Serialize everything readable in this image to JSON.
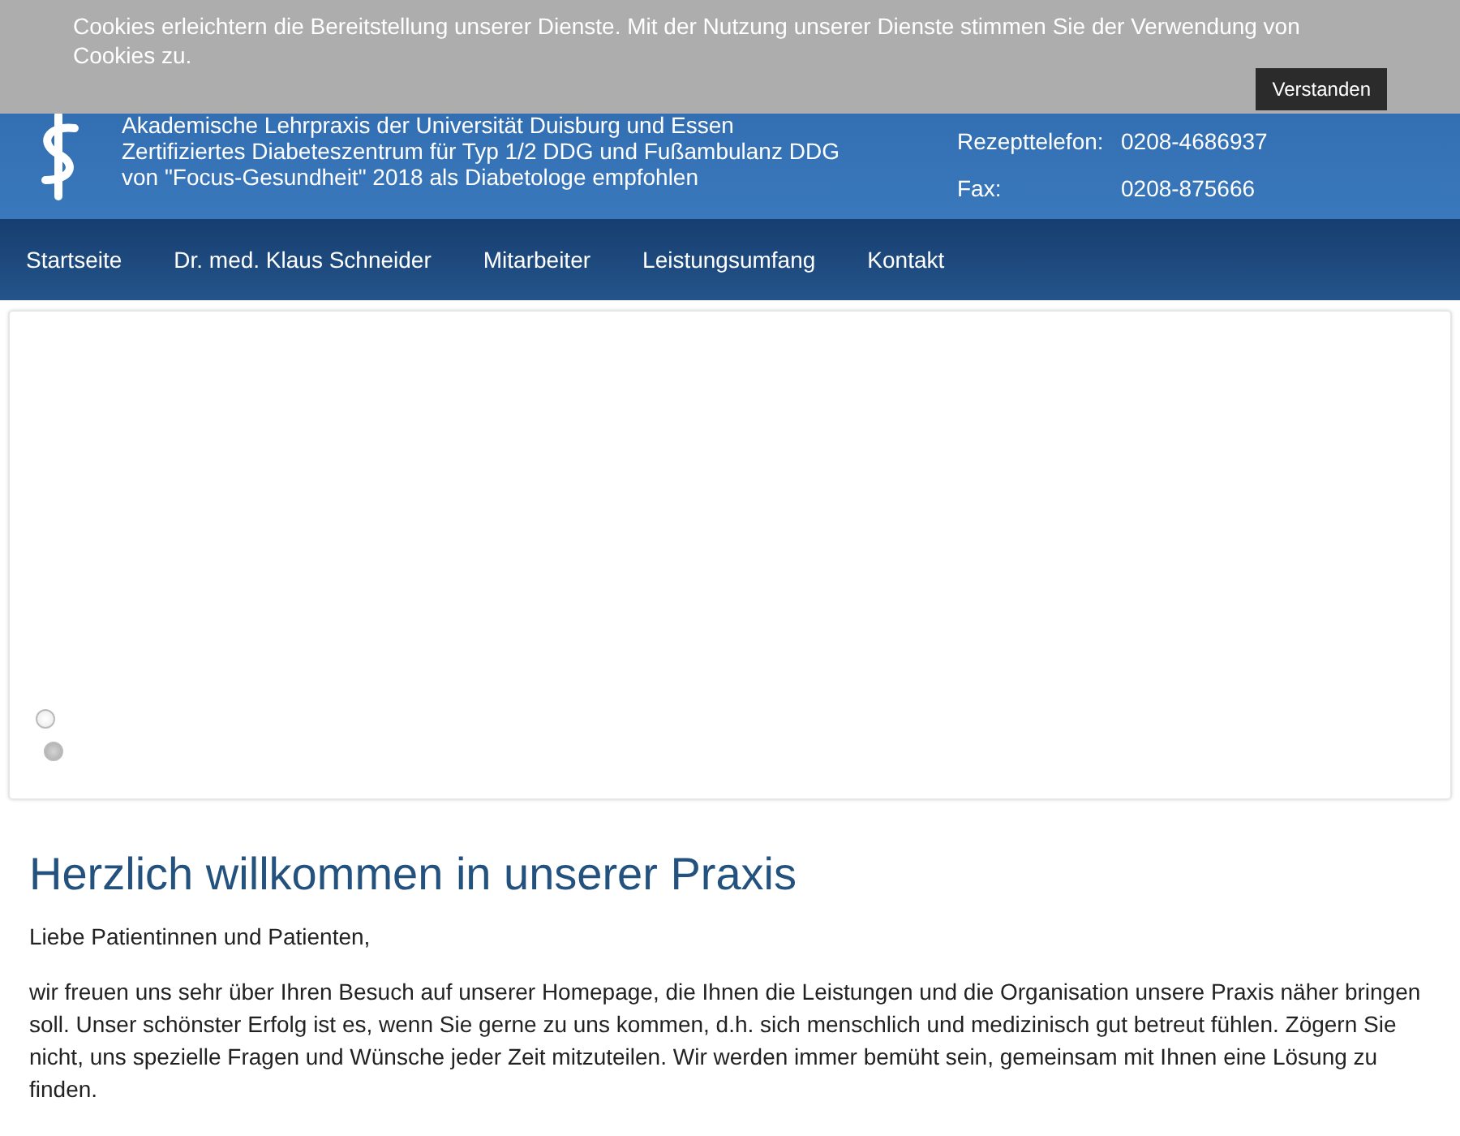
{
  "cookie_banner": {
    "message": "Cookies erleichtern die Bereitstellung unserer Dienste. Mit der Nutzung unserer Dienste stimmen Sie der Verwendung von Cookies zu.",
    "button": "Verstanden"
  },
  "header": {
    "lines": [
      "Akademische Lehrpraxis der Universität Duisburg und Essen",
      "Zertifiziertes Diabeteszentrum für Typ 1/2 DDG und Fußambulanz DDG",
      "von \"Focus-Gesundheit\" 2018 als Diabetologe empfohlen"
    ],
    "contacts": [
      {
        "label": "Rezepttelefon:",
        "value": "0208-4686937"
      },
      {
        "label": "Fax:",
        "value": "0208-875666"
      }
    ]
  },
  "nav": [
    {
      "label": "Startseite"
    },
    {
      "label": "Dr. med. Klaus Schneider"
    },
    {
      "label": "Mitarbeiter"
    },
    {
      "label": "Leistungsumfang"
    },
    {
      "label": "Kontakt"
    }
  ],
  "slider": {
    "dots": [
      {
        "selected": false
      },
      {
        "selected": true
      }
    ]
  },
  "content": {
    "heading": "Herzlich willkommen in unserer Praxis",
    "paragraphs": [
      "Liebe Patientinnen und Patienten,",
      "wir freuen uns sehr über Ihren Besuch auf unserer Homepage, die Ihnen die Leistungen und die Organisation unsere Praxis näher bringen soll. Unser schönster Erfolg ist es, wenn Sie gerne zu uns kommen, d.h. sich menschlich und medizinisch gut betreut fühlen. Zögern Sie nicht, uns spezielle Fragen und Wünsche jeder Zeit mitzuteilen. Wir werden immer bemüht sein, gemeinsam mit Ihnen eine Lösung zu finden."
    ]
  }
}
